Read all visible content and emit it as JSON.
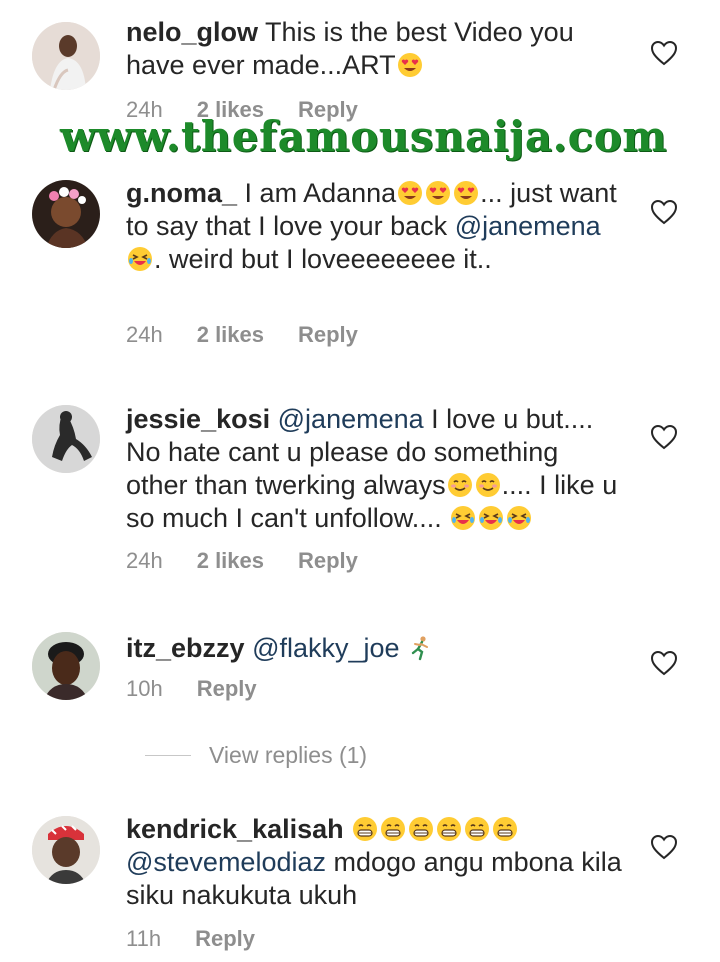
{
  "watermark": "www.thefamousnaija.com",
  "comments": [
    {
      "username": "nelo_glow",
      "text": "This is the best Video you have ever made...ART",
      "emojis": [
        "heart-eyes"
      ],
      "time": "24h",
      "likes": "2 likes",
      "reply": "Reply"
    },
    {
      "username": "g.noma_",
      "text_a": "I am Adanna",
      "emojis_a": [
        "heart-eyes",
        "heart-eyes",
        "heart-eyes"
      ],
      "text_b": "... just want to say that I love your back",
      "mention": "@janemena",
      "emojis_b": [
        "laughing-tears"
      ],
      "text_c": ". weird but I loveeeeeeee it..",
      "time": "24h",
      "likes": "2 likes",
      "reply": "Reply"
    },
    {
      "username": "jessie_kosi",
      "mention": "@janemena",
      "text_a": "I love u but.... No hate cant u please do something other than twerking always",
      "emojis_a": [
        "blush",
        "blush"
      ],
      "text_b": ".... I like u so much I can't unfollow....",
      "emojis_b": [
        "laughing-tears",
        "laughing-tears",
        "laughing-tears"
      ],
      "time": "24h",
      "likes": "2 likes",
      "reply": "Reply"
    },
    {
      "username": "itz_ebzzy",
      "mention": "@flakky_joe",
      "emojis": [
        "runner"
      ],
      "time": "10h",
      "reply": "Reply",
      "view_replies": "View replies (1)"
    },
    {
      "username": "kendrick_kalisah",
      "emojis": [
        "grin",
        "grin",
        "grin",
        "grin",
        "grin",
        "grin"
      ],
      "mention": "@stevemelodiaz",
      "text": "mdogo angu mbona kila siku nakukuta ukuh",
      "time": "11h",
      "reply": "Reply"
    }
  ],
  "colors": {
    "text": "#262626",
    "meta": "#8e8e8e",
    "mention": "#1f3c5a",
    "watermark": "#1d8a2a"
  }
}
